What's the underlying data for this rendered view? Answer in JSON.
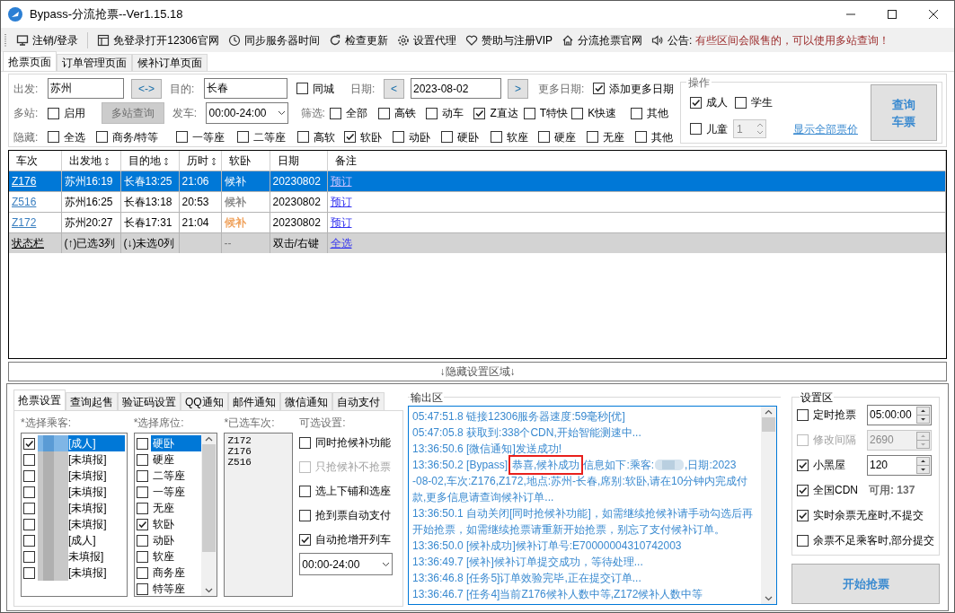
{
  "window": {
    "title": "Bypass-分流抢票--Ver1.15.18"
  },
  "toolbar": [
    {
      "label": "注销/登录"
    },
    {
      "label": "免登录打开12306官网"
    },
    {
      "label": "同步服务器时间"
    },
    {
      "label": "检查更新"
    },
    {
      "label": "设置代理"
    },
    {
      "label": "赞助与注册VIP"
    },
    {
      "label": "分流抢票官网"
    },
    {
      "label": "公告:"
    }
  ],
  "announcement": "有些区间会限售的，可以使用多站查询！",
  "main_tabs": [
    {
      "label": "抢票页面",
      "selected": true
    },
    {
      "label": "订单管理页面",
      "selected": false
    },
    {
      "label": "候补订单页面",
      "selected": false
    }
  ],
  "search": {
    "from_label": "出发:",
    "from": "苏州",
    "swap": "<->",
    "to_label": "目的:",
    "to": "长春",
    "same_city": {
      "label": "同城",
      "checked": false
    },
    "date_label": "日期:",
    "prev": "<",
    "date": "2023-08-02",
    "next": ">",
    "more_dates_label": "更多日期:",
    "more_dates": {
      "label": "添加更多日期",
      "checked": true
    },
    "multi_label": "多站:",
    "multi_enable": {
      "label": "启用",
      "checked": false
    },
    "multi_query": "多站查询",
    "depart_label": "发车:",
    "depart": "00:00-24:00",
    "filter_label": "筛选:",
    "filters": [
      {
        "label": "全部",
        "checked": false
      },
      {
        "label": "高铁",
        "checked": false
      },
      {
        "label": "动车",
        "checked": false
      },
      {
        "label": "Z直达",
        "checked": true
      },
      {
        "label": "T特快",
        "checked": false
      },
      {
        "label": "K快速",
        "checked": false
      },
      {
        "label": "其他",
        "checked": false
      }
    ],
    "hide_label": "隐藏:",
    "hides": [
      {
        "label": "全选",
        "checked": false
      },
      {
        "label": "商务/特等",
        "checked": false
      },
      {
        "label": "一等座",
        "checked": false
      },
      {
        "label": "二等座",
        "checked": false
      },
      {
        "label": "高软",
        "checked": false
      },
      {
        "label": "软卧",
        "checked": true
      },
      {
        "label": "动卧",
        "checked": false
      },
      {
        "label": "硬卧",
        "checked": false
      },
      {
        "label": "软座",
        "checked": false
      },
      {
        "label": "硬座",
        "checked": false
      },
      {
        "label": "无座",
        "checked": false
      },
      {
        "label": "其他",
        "checked": false
      }
    ]
  },
  "operation": {
    "title": "操作",
    "adult": {
      "label": "成人",
      "checked": true
    },
    "student": {
      "label": "学生",
      "checked": false
    },
    "child": {
      "label": "儿童",
      "checked": false
    },
    "child_count": "1",
    "show_prices": "显示全部票价",
    "query_button": [
      "查询",
      "车票"
    ]
  },
  "table": {
    "columns": [
      {
        "label": "车次",
        "sortable": false
      },
      {
        "label": "出发地",
        "sortable": true
      },
      {
        "label": "目的地",
        "sortable": true
      },
      {
        "label": "历时",
        "sortable": true
      },
      {
        "label": "软卧",
        "sortable": false
      },
      {
        "label": "日期",
        "sortable": false
      },
      {
        "label": "备注",
        "sortable": false
      }
    ],
    "rows": [
      {
        "selected": true,
        "train": "Z176",
        "from": "苏州16:19",
        "to": "长春13:25",
        "duration": "21:06",
        "soft_sleeper": "候补",
        "date": "20230802",
        "note": "预订"
      },
      {
        "selected": false,
        "train": "Z516",
        "from": "苏州16:25",
        "to": "长春13:18",
        "duration": "20:53",
        "soft_sleeper": "候补",
        "color": "#8c8c8c",
        "date": "20230802",
        "note": "预订"
      },
      {
        "selected": false,
        "train": "Z172",
        "from": "苏州20:27",
        "to": "长春17:31",
        "duration": "21:04",
        "soft_sleeper": "候补",
        "color": "#f0a35e",
        "date": "20230802",
        "note": "预订"
      }
    ],
    "status_row": {
      "label": "状态栏",
      "selected": "(↑)已选3列",
      "unselected": "(↓)未选0列",
      "soft_sleeper": "--",
      "hint": "双击/右键",
      "select_all": "全选"
    }
  },
  "collapse_bar": "↓隐藏设置区域↓",
  "settings_tabs": [
    {
      "label": "抢票设置",
      "selected": true
    },
    {
      "label": "查询起售",
      "selected": false
    },
    {
      "label": "验证码设置",
      "selected": false
    },
    {
      "label": "QQ通知",
      "selected": false
    },
    {
      "label": "邮件通知",
      "selected": false
    },
    {
      "label": "微信通知",
      "selected": false
    },
    {
      "label": "自动支付",
      "selected": false
    }
  ],
  "passengers_label": "*选择乘客:",
  "passengers": [
    {
      "label": "[成人]",
      "checked": true,
      "selected": true
    },
    {
      "label": "[未填报]",
      "checked": false,
      "selected": false
    },
    {
      "label": "[未填报]",
      "checked": false,
      "selected": false
    },
    {
      "label": "[未填报]",
      "checked": false,
      "selected": false
    },
    {
      "label": "[未填报]",
      "checked": false,
      "selected": false
    },
    {
      "label": "[未填报]",
      "checked": false,
      "selected": false
    },
    {
      "label": "[成人]",
      "checked": false,
      "selected": false
    },
    {
      "label": "未填报]",
      "checked": false,
      "selected": false
    },
    {
      "label": "[未填报]",
      "checked": false,
      "selected": false
    }
  ],
  "seats_label": "*选择席位:",
  "seats": [
    {
      "label": "硬卧",
      "checked": false,
      "selected": true
    },
    {
      "label": "硬座",
      "checked": false,
      "selected": false
    },
    {
      "label": "二等座",
      "checked": false,
      "selected": false
    },
    {
      "label": "一等座",
      "checked": false,
      "selected": false
    },
    {
      "label": "无座",
      "checked": false,
      "selected": false
    },
    {
      "label": "软卧",
      "checked": true,
      "selected": false
    },
    {
      "label": "动卧",
      "checked": false,
      "selected": false
    },
    {
      "label": "软座",
      "checked": false,
      "selected": false
    },
    {
      "label": "商务座",
      "checked": false,
      "selected": false
    },
    {
      "label": "特等座",
      "checked": false,
      "selected": false
    }
  ],
  "trains_label": "*已选车次:",
  "trains": [
    "Z172",
    "Z176",
    "Z516"
  ],
  "options_label": "可选设置:",
  "options": [
    {
      "label": "同时抢候补功能",
      "checked": false,
      "disabled": false
    },
    {
      "label": "只抢候补不抢票",
      "checked": false,
      "disabled": true
    },
    {
      "label": "选上下铺和选座",
      "checked": false,
      "disabled": false
    },
    {
      "label": "抢到票自动支付",
      "checked": false,
      "disabled": false
    },
    {
      "label": "自动抢增开列车",
      "checked": true,
      "disabled": false
    }
  ],
  "auto_time": "00:00-24:00",
  "output": {
    "title": "输出区",
    "lines": [
      {
        "time": "05:47:51.8",
        "text": "链接12306服务器速度:59毫秒[优]"
      },
      {
        "time": "05:47:05.8",
        "text": "获取到:338个CDN,开始智能测速中..."
      },
      {
        "time": "13:36:50.6",
        "text": "[微信通知]发送成功!"
      },
      {
        "time": "13:36:50.2",
        "text": "[Bypass]",
        "highlight": "恭喜,候补成功",
        "after": "信息如下:乘客:",
        "rest": [
          ",日期:2023",
          "-08-02,车次:Z176,Z172,地点:苏州-长春,席别:软卧,请在10分钟内完成付",
          "款,更多信息请查询候补订单..."
        ]
      },
      {
        "time": "13:36:50.1",
        "text": "自动关闭[同时抢候补功能]，如需继续抢候补请手动勾选后再开始抢票，如需继续抢票请重新开始抢票，别忘了支付候补订单。"
      },
      {
        "time": "13:36:50.0",
        "text": "[候补成功]候补订单号:E70000004310742003"
      },
      {
        "time": "13:36:49.7",
        "text": "[候补]候补订单提交成功，等待处理..."
      },
      {
        "time": "13:36:46.8",
        "text": "[任务5]订单效验完毕,正在提交订单..."
      },
      {
        "time": "13:36:46.7",
        "text": "[任务4]当前Z176候补人数中等,Z172候补人数中等"
      }
    ]
  },
  "settings": {
    "title": "设置区",
    "items": [
      {
        "kind": "spin",
        "label": "定时抢票",
        "checked": false,
        "value": "05:00:00",
        "disabled": false
      },
      {
        "kind": "spin",
        "label": "修改间隔",
        "checked": false,
        "value": "2690",
        "disabled": true
      },
      {
        "kind": "spin",
        "label": "小黑屋",
        "checked": true,
        "value": "120",
        "disabled": false
      },
      {
        "kind": "count",
        "label": "全国CDN",
        "checked": true,
        "note": "可用:",
        "count": "137"
      },
      {
        "kind": "check",
        "label": "实时余票无座时,不提交",
        "checked": true
      },
      {
        "kind": "check",
        "label": "余票不足乘客时,部分提交",
        "checked": false
      }
    ],
    "start_button": "开始抢票"
  }
}
